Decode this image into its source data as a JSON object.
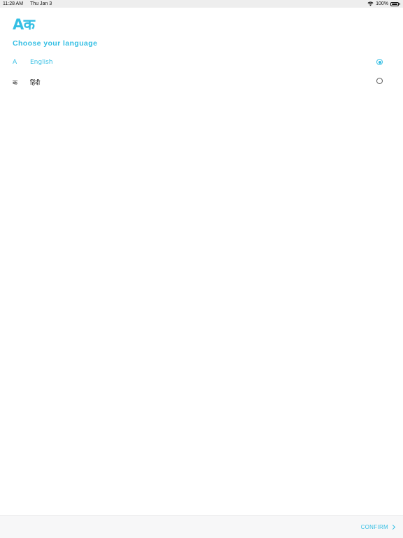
{
  "status_bar": {
    "time": "11:28 AM",
    "date": "Thu Jan 3",
    "battery": "100%"
  },
  "app": {
    "logo": "Aक",
    "heading": "Choose your language"
  },
  "languages": [
    {
      "glyph": "A",
      "name": "English",
      "selected": true
    },
    {
      "glyph": "क",
      "name": "हिंदी",
      "selected": false
    }
  ],
  "footer": {
    "confirm_label": "CONFIRM"
  },
  "colors": {
    "accent": "#35bfe4",
    "text": "#111111",
    "footer_bg": "#f7f7f8"
  }
}
